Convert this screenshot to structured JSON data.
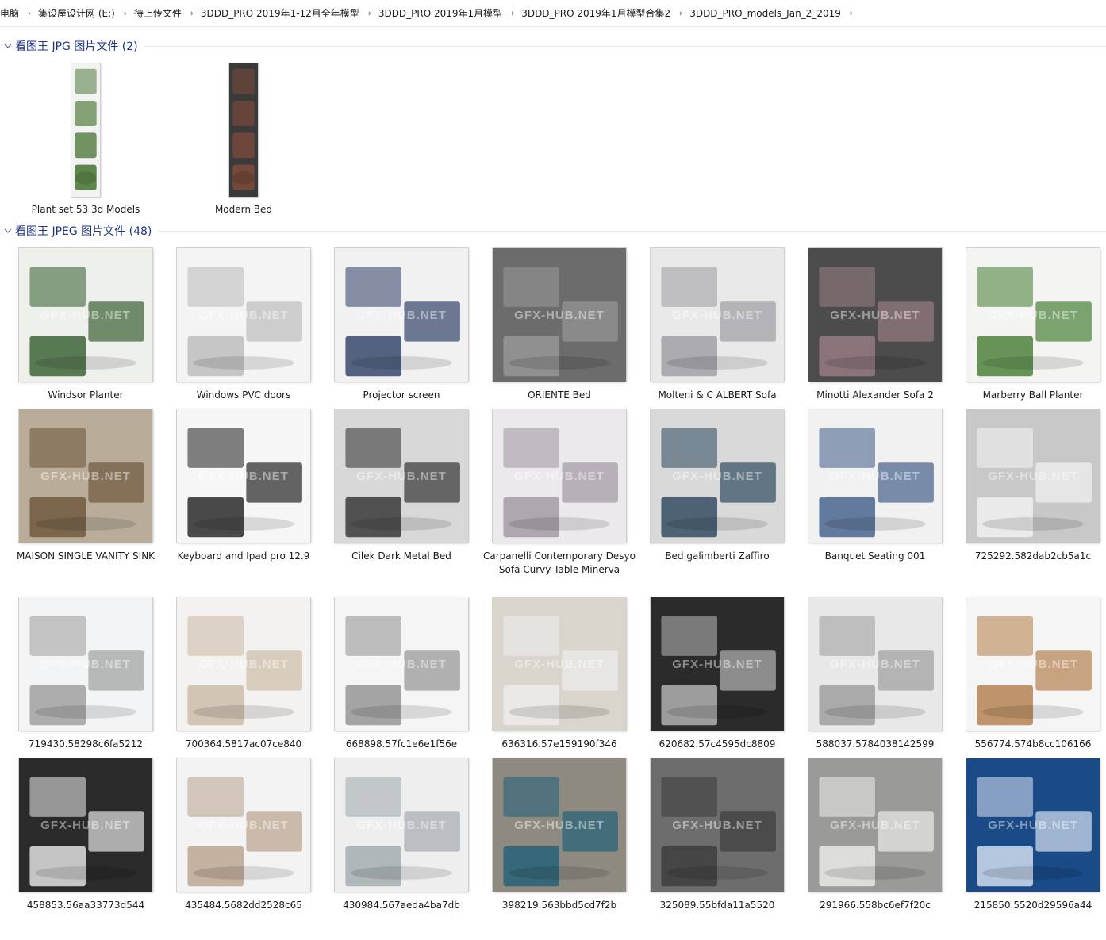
{
  "breadcrumb": [
    "电脑",
    "集设屋设计网 (E:)",
    "待上传文件",
    "3DDD_PRO 2019年1-12月全年模型",
    "3DDD_PRO 2019年1月模型",
    "3DDD_PRO 2019年1月模型合集2",
    "3DDD_PRO_models_Jan_2_2019"
  ],
  "groups": [
    {
      "title": "看图王 JPG 图片文件 (2)",
      "items": [
        {
          "name": "Plant set 53 3d Models",
          "bg": "#f2f2f2",
          "accent": "#4f7a3a"
        },
        {
          "name": "Modern Bed",
          "bg": "#3a3a3a",
          "accent": "#7a4a3a"
        }
      ]
    },
    {
      "title": "看图王 JPEG 图片文件 (48)",
      "items": [
        {
          "name": "Windsor Planter",
          "bg": "#eef0ec",
          "accent": "#2f5a2a"
        },
        {
          "name": "Windows PVC doors",
          "bg": "#f4f4f4",
          "accent": "#b9b9b9"
        },
        {
          "name": "Projector screen",
          "bg": "#f1f1f1",
          "accent": "#2a3b63"
        },
        {
          "name": "ORIENTE Bed",
          "bg": "#6c6c6c",
          "accent": "#9a9a9a"
        },
        {
          "name": "Molteni & C ALBERT Sofa",
          "bg": "#e9e9e9",
          "accent": "#9a9aa0"
        },
        {
          "name": "Minotti Alexander Sofa 2",
          "bg": "#4c4c4c",
          "accent": "#9b7f86"
        },
        {
          "name": "Marberry Ball Planter",
          "bg": "#f4f4f2",
          "accent": "#3f7a2e"
        },
        {
          "name": "MAISON SINGLE VANITY SINK",
          "bg": "#b9ad9a",
          "accent": "#6b5237"
        },
        {
          "name": "Keyboard and Ipad pro 12.9",
          "bg": "#f6f6f6",
          "accent": "#1b1b1b"
        },
        {
          "name": "Cilek Dark Metal Bed",
          "bg": "#d8d8d8",
          "accent": "#2c2c2c"
        },
        {
          "name": "Carpanelli Contemporary Desyo Sofa Curvy Table Minerva",
          "bg": "#ebe9ec",
          "accent": "#9d949f"
        },
        {
          "name": "Bed galimberti Zaffiro",
          "bg": "#d9d9d9",
          "accent": "#27435a"
        },
        {
          "name": "Banquet Seating 001",
          "bg": "#f1f1f1",
          "accent": "#3c5a86"
        },
        {
          "name": "725292.582dab2cb5a1c",
          "bg": "#c8c8c8",
          "accent": "#f4f4f4"
        },
        {
          "name": "719430.58298c6fa5212",
          "bg": "#f3f4f5",
          "accent": "#9a9a9a"
        },
        {
          "name": "700364.5817ac07ce840",
          "bg": "#f4f2f0",
          "accent": "#c9b9a4"
        },
        {
          "name": "668898.57fc1e6e1f56e",
          "bg": "#f5f5f5",
          "accent": "#8e8e8e"
        },
        {
          "name": "636316.57e159190f346",
          "bg": "#d9d4cc",
          "accent": "#eeeeee"
        },
        {
          "name": "620682.57c4595dc8809",
          "bg": "#2b2b2b",
          "accent": "#bcbcbc"
        },
        {
          "name": "588037.5784038142599",
          "bg": "#e8e8e8",
          "accent": "#9a9a9a"
        },
        {
          "name": "556774.574b8cc106166",
          "bg": "#f5f5f5",
          "accent": "#b07a45"
        },
        {
          "name": "458853.56aa33773d544",
          "bg": "#2a2a2a",
          "accent": "#efefef"
        },
        {
          "name": "435484.5682dd2528c65",
          "bg": "#f3f3f3",
          "accent": "#b79e88"
        },
        {
          "name": "430984.567aeda4ba7db",
          "bg": "#eeeeee",
          "accent": "#9ea7ad"
        },
        {
          "name": "398219.563bbd5cd7f2b",
          "bg": "#8f8a80",
          "accent": "#1f5f79"
        },
        {
          "name": "325089.55bfda11a5520",
          "bg": "#6d6d6d",
          "accent": "#3a3a3a"
        },
        {
          "name": "291966.558bc6ef7f20c",
          "bg": "#9a9a98",
          "accent": "#eeeeee"
        },
        {
          "name": "215850.5520d29596a44",
          "bg": "#1b4b87",
          "accent": "#dfe8f5"
        }
      ]
    }
  ],
  "watermark": "GFX-HUB.NET"
}
